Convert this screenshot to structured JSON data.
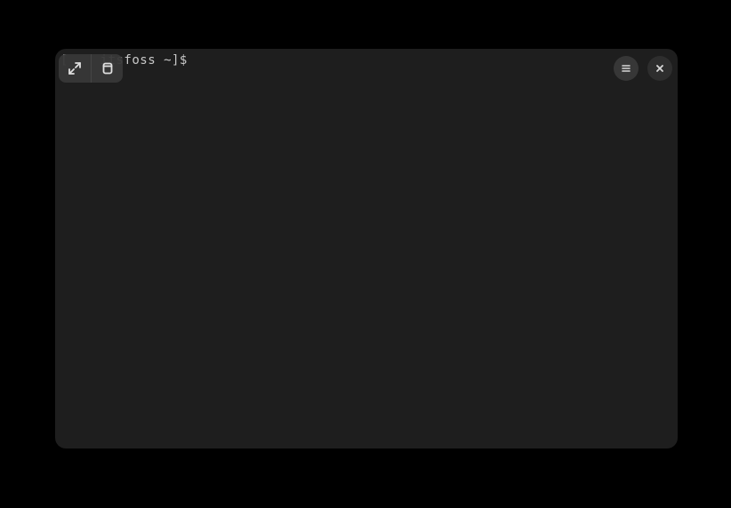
{
  "terminal": {
    "prompt": "[    itsfoss ~]$ "
  },
  "toolbar": {
    "expand_label": "expand",
    "copy_label": "copy",
    "menu_label": "menu",
    "close_label": "close"
  }
}
